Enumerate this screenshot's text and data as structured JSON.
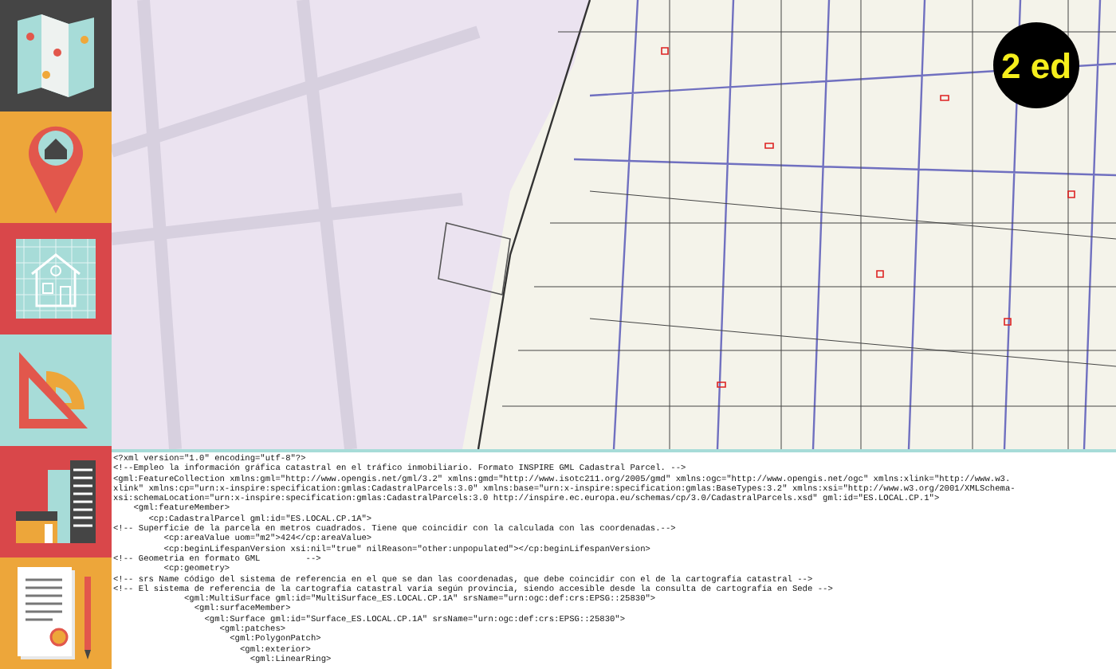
{
  "badge": {
    "text": "2 ed"
  },
  "xml_listing": {
    "lines": [
      "<?xml version=\"1.0\" encoding=\"utf-8\"?>",
      "<!--Empleo la información gráfica catastral en el tráfico inmobiliario. Formato INSPIRE GML Cadastral Parcel. -->",
      "<gml:FeatureCollection xmlns:gml=\"http://www.opengis.net/gml/3.2\" xmlns:gmd=\"http://www.isotc211.org/2005/gmd\" xmlns:ogc=\"http://www.opengis.net/ogc\" xmlns:xlink=\"http://www.w3.",
      "xlink\" xmlns:cp=\"urn:x-inspire:specification:gmlas:CadastralParcels:3.0\" xmlns:base=\"urn:x-inspire:specification:gmlas:BaseTypes:3.2\" xmlns:xsi=\"http://www.w3.org/2001/XMLSchema-",
      "xsi:schemaLocation=\"urn:x-inspire:specification:gmlas:CadastralParcels:3.0 http://inspire.ec.europa.eu/schemas/cp/3.0/CadastralParcels.xsd\" gml:id=\"ES.LOCAL.CP.1\">",
      "    <gml:featureMember>",
      "       <cp:CadastralParcel gml:id=\"ES.LOCAL.CP.1A\">",
      "<!-- Superficie de la parcela en metros cuadrados. Tiene que coincidir con la calculada con las coordenadas.-->",
      "          <cp:areaValue uom=\"m2\">424</cp:areaValue>",
      "          <cp:beginLifespanVersion xsi:nil=\"true\" nilReason=\"other:unpopulated\"></cp:beginLifespanVersion>",
      "<!-- Geometria en formato GML         -->",
      "          <cp:geometry>",
      "<!-- srs Name código del sistema de referencia en el que se dan las coordenadas, que debe coincidir con el de la cartografía catastral -->",
      "<!-- El sistema de referencia de la cartografía catastral varía según provincia, siendo accesible desde la consulta de cartografía en Sede -->",
      "              <gml:MultiSurface gml:id=\"MultiSurface_ES.LOCAL.CP.1A\" srsName=\"urn:ogc:def:crs:EPSG::25830\">",
      "                <gml:surfaceMember>",
      "                  <gml:Surface gml:id=\"Surface_ES.LOCAL.CP.1A\" srsName=\"urn:ogc:def:crs:EPSG::25830\">",
      "                     <gml:patches>",
      "                       <gml:PolygonPatch>",
      "                         <gml:exterior>",
      "                           <gml:LinearRing>"
    ]
  }
}
